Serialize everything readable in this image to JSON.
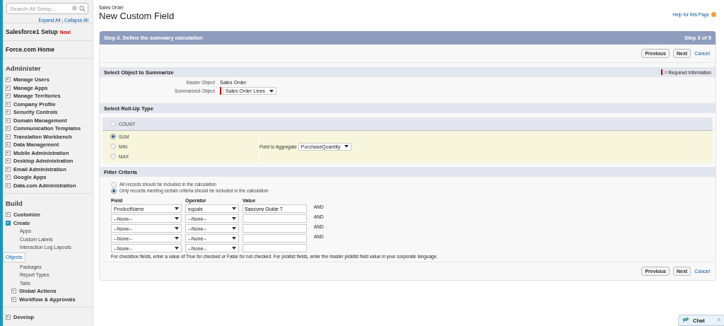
{
  "sidebar": {
    "search": {
      "placeholder": "Search All Setup..."
    },
    "expand_all": "Expand All",
    "collapse_all": "Collapse All",
    "separator": "|",
    "top_links": [
      {
        "label": "Salesforce1 Setup",
        "badge": "New!"
      },
      {
        "label": "Force.com Home"
      }
    ],
    "sections": [
      {
        "title": "Administer",
        "items": [
          {
            "label": "Manage Users",
            "expanded": false
          },
          {
            "label": "Manage Apps",
            "expanded": false
          },
          {
            "label": "Manage Territories",
            "expanded": false
          },
          {
            "label": "Company Profile",
            "expanded": false
          },
          {
            "label": "Security Controls",
            "expanded": false
          },
          {
            "label": "Domain Management",
            "expanded": false
          },
          {
            "label": "Communication Templates",
            "expanded": false
          },
          {
            "label": "Translation Workbench",
            "expanded": false
          },
          {
            "label": "Data Management",
            "expanded": false
          },
          {
            "label": "Mobile Administration",
            "expanded": false
          },
          {
            "label": "Desktop Administration",
            "expanded": false
          },
          {
            "label": "Email Administration",
            "expanded": false
          },
          {
            "label": "Google Apps",
            "expanded": false
          },
          {
            "label": "Data.com Administration",
            "expanded": false
          }
        ]
      },
      {
        "title": "Build",
        "items": [
          {
            "label": "Customize",
            "expanded": false
          },
          {
            "label": "Create",
            "expanded": true,
            "children": [
              {
                "label": "Apps",
                "selected": false
              },
              {
                "label": "Custom Labels",
                "selected": false
              },
              {
                "label": "Interaction Log Layouts",
                "selected": false
              },
              {
                "label": "Objects",
                "selected": true
              },
              {
                "label": "Packages",
                "selected": false
              },
              {
                "label": "Report Types",
                "selected": false
              },
              {
                "label": "Tabs",
                "selected": false
              },
              {
                "label": "Global Actions",
                "expanded": false
              },
              {
                "label": "Workflow & Approvals",
                "expanded": false
              }
            ]
          }
        ]
      },
      {
        "items": [
          {
            "label": "Develop",
            "expanded": false
          }
        ]
      }
    ]
  },
  "page": {
    "breadcrumb": "Sales Order",
    "title": "New Custom Field",
    "help": "Help for this Page"
  },
  "wizard": {
    "step_title": "Step 3. Define the summary calculation",
    "step_count": "Step 3 of 5",
    "top_buttons": {
      "buttons": [
        "Previous",
        "Next"
      ],
      "cancel": "Cancel"
    },
    "object_section": {
      "title": "Select Object to Summarize",
      "required_note": "= Required Information",
      "fields": [
        {
          "label": "Master Object",
          "kind": "text",
          "value": "Sales Order"
        },
        {
          "label": "Summarized Object",
          "kind": "select",
          "value": "Sales Order Lines",
          "required": true
        }
      ]
    },
    "rollup_section": {
      "title": "Select Roll-Up Type",
      "types": [
        {
          "label": "COUNT",
          "selected": false
        },
        {
          "label": "SUM",
          "selected": true
        },
        {
          "label": "MIN",
          "selected": false
        },
        {
          "label": "MAX",
          "selected": false
        }
      ],
      "aggregate_label": "Field to Aggregate",
      "aggregate_value": "PurchaseQuantity"
    },
    "filter_section": {
      "title": "Filter Criteria",
      "options": [
        {
          "label": "All records should be included in the calculation",
          "selected": false
        },
        {
          "label": "Only records meeting certain criteria should be included in the calculation",
          "selected": true
        }
      ],
      "columns": [
        "Field",
        "Operator",
        "Value"
      ],
      "rows": [
        {
          "field": "ProductName",
          "operator": "equals",
          "value": "Saucony Guide 7",
          "connector": "AND"
        },
        {
          "field": "--None--",
          "operator": "--None--",
          "connector": "AND"
        },
        {
          "field": "--None--",
          "operator": "--None--",
          "connector": "AND"
        },
        {
          "field": "--None--",
          "operator": "--None--",
          "connector": "AND"
        },
        {
          "field": "--None--",
          "operator": "--None--"
        }
      ],
      "note": "For checkbox fields, enter a value of True for checked or False for not checked. For picklist fields, enter the master picklist field value in your corporate language."
    },
    "bottom_buttons": {
      "buttons": [
        "Previous",
        "Next"
      ],
      "cancel": "Cancel"
    }
  },
  "chat": {
    "label": "Chat"
  }
}
